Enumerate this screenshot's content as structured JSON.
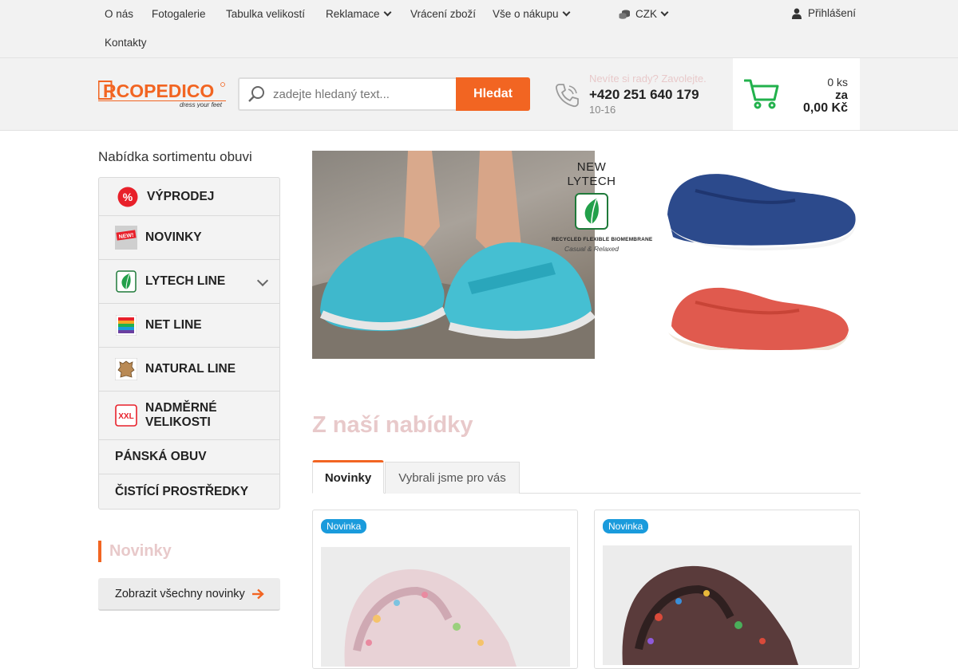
{
  "topnav": {
    "items": [
      "O nás",
      "Fotogalerie",
      "Tabulka velikostí",
      "Reklamace",
      "Vrácení zboží",
      "Vše o nákupu",
      "Kontakty"
    ],
    "currency": "CZK",
    "login": "Přihlášení"
  },
  "header": {
    "logo_text": "ARCOPEDICO",
    "logo_tagline": "dress your feet",
    "search_placeholder": "zadejte hledaný text...",
    "search_button": "Hledat",
    "contact_hint": "Nevíte si rady? Zavolejte.",
    "phone": "+420 251 640 179",
    "hours": "10-16"
  },
  "cart": {
    "count": "0 ks",
    "prefix": "za",
    "price": "0,00 Kč"
  },
  "sidebar": {
    "title": "Nabídka sortimentu obuvi",
    "categories": [
      {
        "label": "VÝPRODEJ",
        "icon": "percent-icon"
      },
      {
        "label": "NOVINKY",
        "icon": "new-icon"
      },
      {
        "label": "LYTECH LINE",
        "icon": "leaf-icon"
      },
      {
        "label": "NET LINE",
        "icon": "net-icon"
      },
      {
        "label": "NATURAL LINE",
        "icon": "leather-icon"
      },
      {
        "label": "NADMĚRNÉ VELIKOSTI",
        "icon": "xxl-icon"
      },
      {
        "label": "PÁNSKÁ OBUV",
        "icon": ""
      },
      {
        "label": "ČISTÍCÍ PROSTŘEDKY",
        "icon": ""
      }
    ],
    "new_icon_text": "NEW!",
    "xxl_icon_text": "XXL",
    "novinky_heading": "Novinky",
    "show_all": "Zobrazit všechny novinky"
  },
  "banner": {
    "title": "NEW LYTECH",
    "subtitle": "RECYCLED FLEXIBLE BIOMEMBRANE",
    "tagline": "Casual & Relaxed"
  },
  "offers": {
    "title": "Z naší nabídky",
    "tabs": [
      "Novinky",
      "Vybrali jsme pro vás"
    ],
    "products": [
      {
        "badge": "Novinka"
      },
      {
        "badge": "Novinka"
      }
    ]
  },
  "colors": {
    "accent": "#f26522",
    "badge": "#1a9bdc",
    "green": "#22b14c",
    "muted_title": "#e8c9ca"
  }
}
